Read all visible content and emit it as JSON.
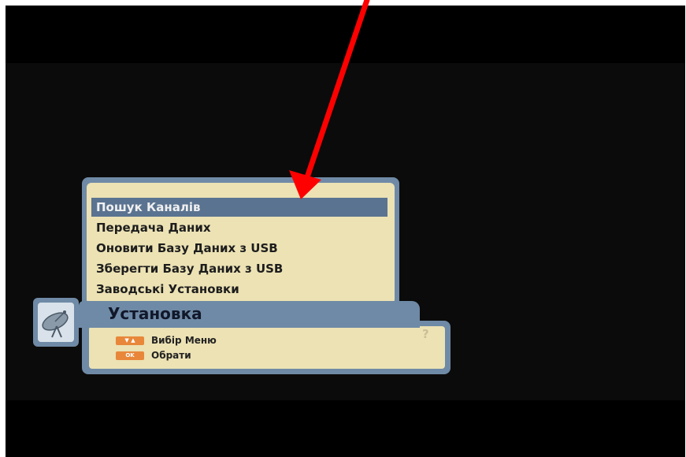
{
  "menu": {
    "items": [
      {
        "label": "Пошук Каналів",
        "selected": true
      },
      {
        "label": "Передача Даних",
        "selected": false
      },
      {
        "label": "Оновити Базу Даних з USB",
        "selected": false
      },
      {
        "label": "Зберегти Базу Даних з USB",
        "selected": false
      },
      {
        "label": "Заводські Установки",
        "selected": false
      }
    ],
    "title": "Установка"
  },
  "hints": [
    {
      "key": "▼ ▲",
      "label": "Вибір Меню"
    },
    {
      "key": "OK",
      "label": "Обрати"
    }
  ],
  "help_symbol": "?",
  "icons": {
    "menu_icon": "satellite-dish-icon"
  },
  "colors": {
    "panel_bg": "#ece2b4",
    "frame": "#6f8aa6",
    "selected_bg": "#5a7390",
    "key_bg": "#e8873a",
    "annotation_arrow": "#ff0000"
  }
}
